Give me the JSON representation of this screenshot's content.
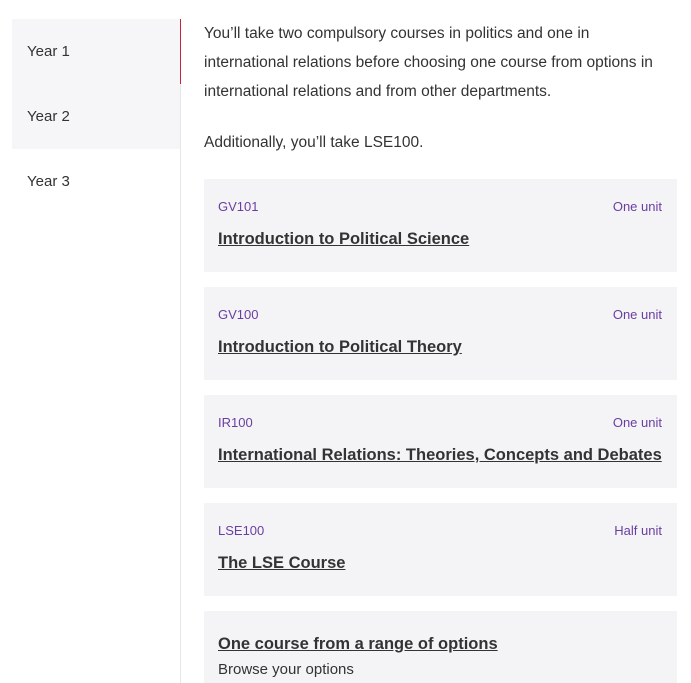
{
  "years": [
    {
      "label": "Year 1"
    },
    {
      "label": "Year 2"
    },
    {
      "label": "Year 3"
    }
  ],
  "content": {
    "intro": "You’ll take two compulsory courses in politics and one in international relations before choosing one course from options in international relations and from other departments.",
    "additional": "Additionally, you’ll take LSE100.",
    "courses": [
      {
        "code": "GV101",
        "unit": "One unit",
        "title": "Introduction to Political Science"
      },
      {
        "code": "GV100",
        "unit": "One unit",
        "title": "Introduction to Political Theory"
      },
      {
        "code": "IR100",
        "unit": "One unit",
        "title": "International Relations: Theories, Concepts and Debates"
      },
      {
        "code": "LSE100",
        "unit": "Half unit",
        "title": "The LSE Course"
      }
    ],
    "options": {
      "title": "One course from a range of options",
      "subtitle": "Browse your options"
    }
  },
  "colors": {
    "accent": "#cc2040",
    "course_code": "#6a3ea1",
    "card_bg": "#f4f4f7",
    "tab_bg": "#f6f6f8"
  }
}
